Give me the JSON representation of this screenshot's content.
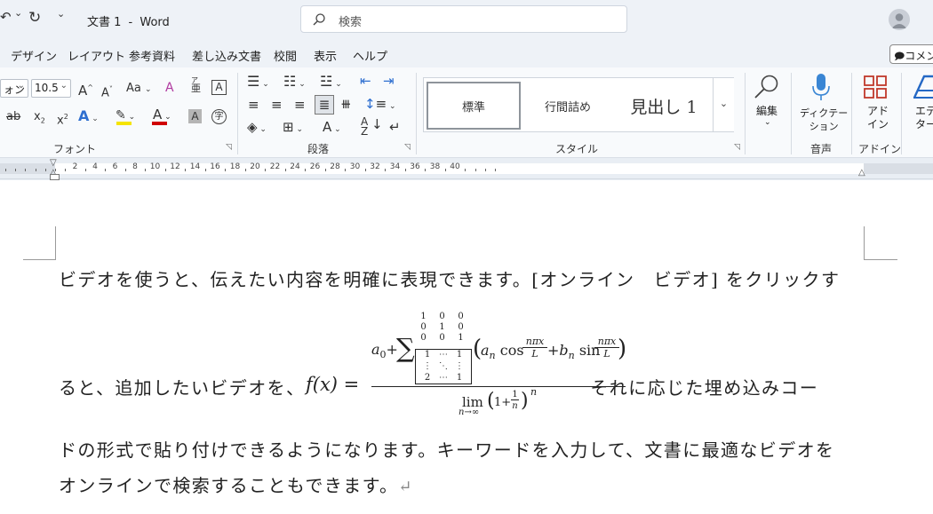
{
  "titlebar": {
    "undo_glyph": "↶",
    "undo_dropdown": "⌄",
    "redo_glyph": "↻",
    "customize_glyph": "⌄",
    "title": "文書 1",
    "separator": "-",
    "app": "Word",
    "search_placeholder": "検索"
  },
  "tabs": [
    "デザイン",
    "レイアウト",
    "参考資料",
    "差し込み文書",
    "校閲",
    "表示",
    "ヘルプ"
  ],
  "comment_button": "コメン",
  "ribbon": {
    "font": {
      "font_name": "ォン",
      "font_size": "10.5",
      "grow": "A",
      "shrink": "A",
      "case": "Aa",
      "clear": "A",
      "phonetic_top": "亜",
      "phonetic_bottom": "ア",
      "border_char": "A",
      "strike": "ab",
      "sub": "x",
      "sub_mark": "2",
      "sup": "x",
      "sup_mark": "2",
      "effects": "A",
      "font_color": "A",
      "shade": "A",
      "enclose": "字",
      "label": "フォント"
    },
    "paragraph": {
      "label": "段落"
    },
    "styles": {
      "items": [
        "標準",
        "行間詰め",
        "見出し 1"
      ],
      "label": "スタイル"
    },
    "editing": {
      "label": "編集"
    },
    "voice": {
      "button": "ディクテー\nション",
      "label": "音声"
    },
    "addins": {
      "button": "アド\nイン",
      "label": "アドイン"
    },
    "editor": {
      "button": "エデ\nター"
    }
  },
  "ruler": {
    "numbers": [
      "2",
      "4",
      "6",
      "8",
      "10",
      "12",
      "14",
      "16",
      "18",
      "20",
      "22",
      "24",
      "26",
      "28",
      "30",
      "32",
      "34",
      "36",
      "38",
      "40"
    ]
  },
  "document": {
    "line1": "ビデオを使うと、伝えたい内容を明確に表現できます。[オンライン　ビデオ] をクリックす",
    "line2_before": "ると、追加したいビデオを、",
    "line2_after": "それに応じた埋め込みコー",
    "line3": "ドの形式で貼り付けできるようになります。キーワードを入力して、文書に最適なビデオを",
    "line4": "オンラインで検索することもできます。",
    "pilcrow": "↵",
    "formula": {
      "lhs": "f(x) =",
      "a0": "a",
      "a0_sub": "0",
      "plus": "+",
      "sigma": "∑",
      "sigma_matrix": [
        [
          "1",
          "0",
          "0"
        ],
        [
          "0",
          "1",
          "0"
        ],
        [
          "0",
          "0",
          "1"
        ]
      ],
      "bracket_matrix": [
        [
          "1",
          "⋯",
          "1"
        ],
        [
          "⋮",
          "⋱",
          "⋮"
        ],
        [
          "2",
          "⋯",
          "1"
        ]
      ],
      "an": "a",
      "an_sub": "n",
      "cos": "cos",
      "bn": "b",
      "bn_sub": "n",
      "sin": "sin",
      "frac_num": "nπx",
      "frac_den": "L",
      "lim": "lim",
      "lim_sub": "n→∞",
      "one": "1+",
      "one_num": "1",
      "one_den": "n",
      "power": "n"
    }
  },
  "colors": {
    "highlight": "#f5e400",
    "font_color": "#d00000",
    "addins_icon": "#c0392b",
    "mic_icon": "#3a86d4",
    "editor_icon": "#2468c5"
  }
}
